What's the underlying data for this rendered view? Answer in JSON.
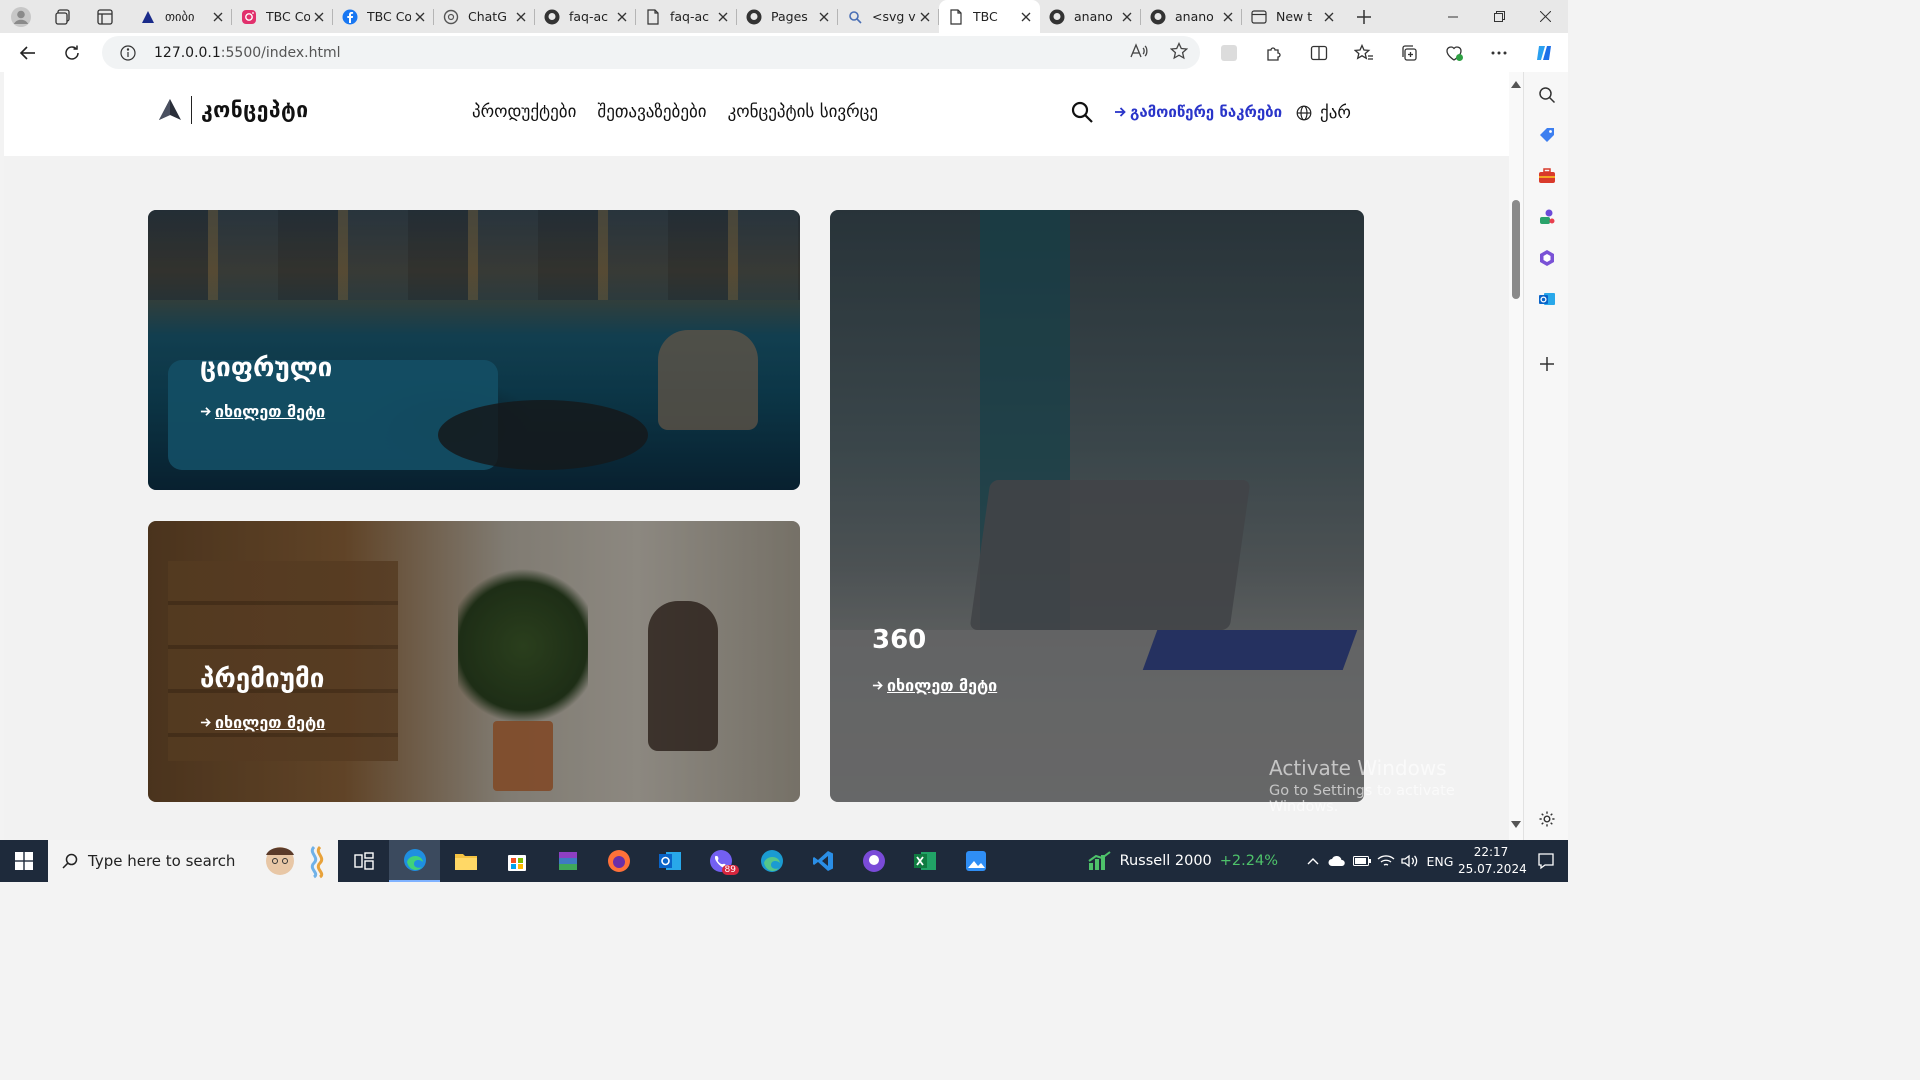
{
  "browser": {
    "tabs": [
      {
        "label": "თიბი",
        "icon": "tbc-logo-icon"
      },
      {
        "label": "TBC Co",
        "icon": "instagram-icon"
      },
      {
        "label": "TBC Co",
        "icon": "facebook-icon"
      },
      {
        "label": "ChatG",
        "icon": "chatgpt-icon"
      },
      {
        "label": "faq-ac",
        "icon": "github-icon"
      },
      {
        "label": "faq-ac",
        "icon": "document-icon"
      },
      {
        "label": "Pages",
        "icon": "github-icon"
      },
      {
        "label": "<svg v",
        "icon": "search-icon"
      },
      {
        "label": "TBC",
        "icon": "document-icon",
        "active": true
      },
      {
        "label": "anano",
        "icon": "github-icon"
      },
      {
        "label": "anano",
        "icon": "github-icon"
      },
      {
        "label": "New t",
        "icon": "newtab-icon"
      }
    ],
    "url_host": "127.0.0.1",
    "url_path": ":5500/index.html"
  },
  "site": {
    "logo_text": "კონცეპტი",
    "nav": [
      "პროდუქტები",
      "შეთავაზებები",
      "კონცეპტის სივრცე"
    ],
    "apply_label": "გამოიწერე ნაკრები",
    "lang_label": "ქარ",
    "accent_color": "#2a35c9"
  },
  "cards": {
    "digital": {
      "title": "ციფრული",
      "more": "იხილეთ მეტი"
    },
    "premium": {
      "title": "პრემიუმი",
      "more": "იხილეთ მეტი"
    },
    "three60": {
      "title": "360",
      "more": "იხილეთ მეტი"
    }
  },
  "watermark": {
    "line1": "Activate Windows",
    "line2": "Go to Settings to activate Windows."
  },
  "taskbar": {
    "search_placeholder": "Type here to search",
    "ticker_name": "Russell 2000",
    "ticker_change": "+2.24%",
    "lang": "ENG",
    "time": "22:17",
    "date": "25.07.2024",
    "viber_badge": "89"
  }
}
